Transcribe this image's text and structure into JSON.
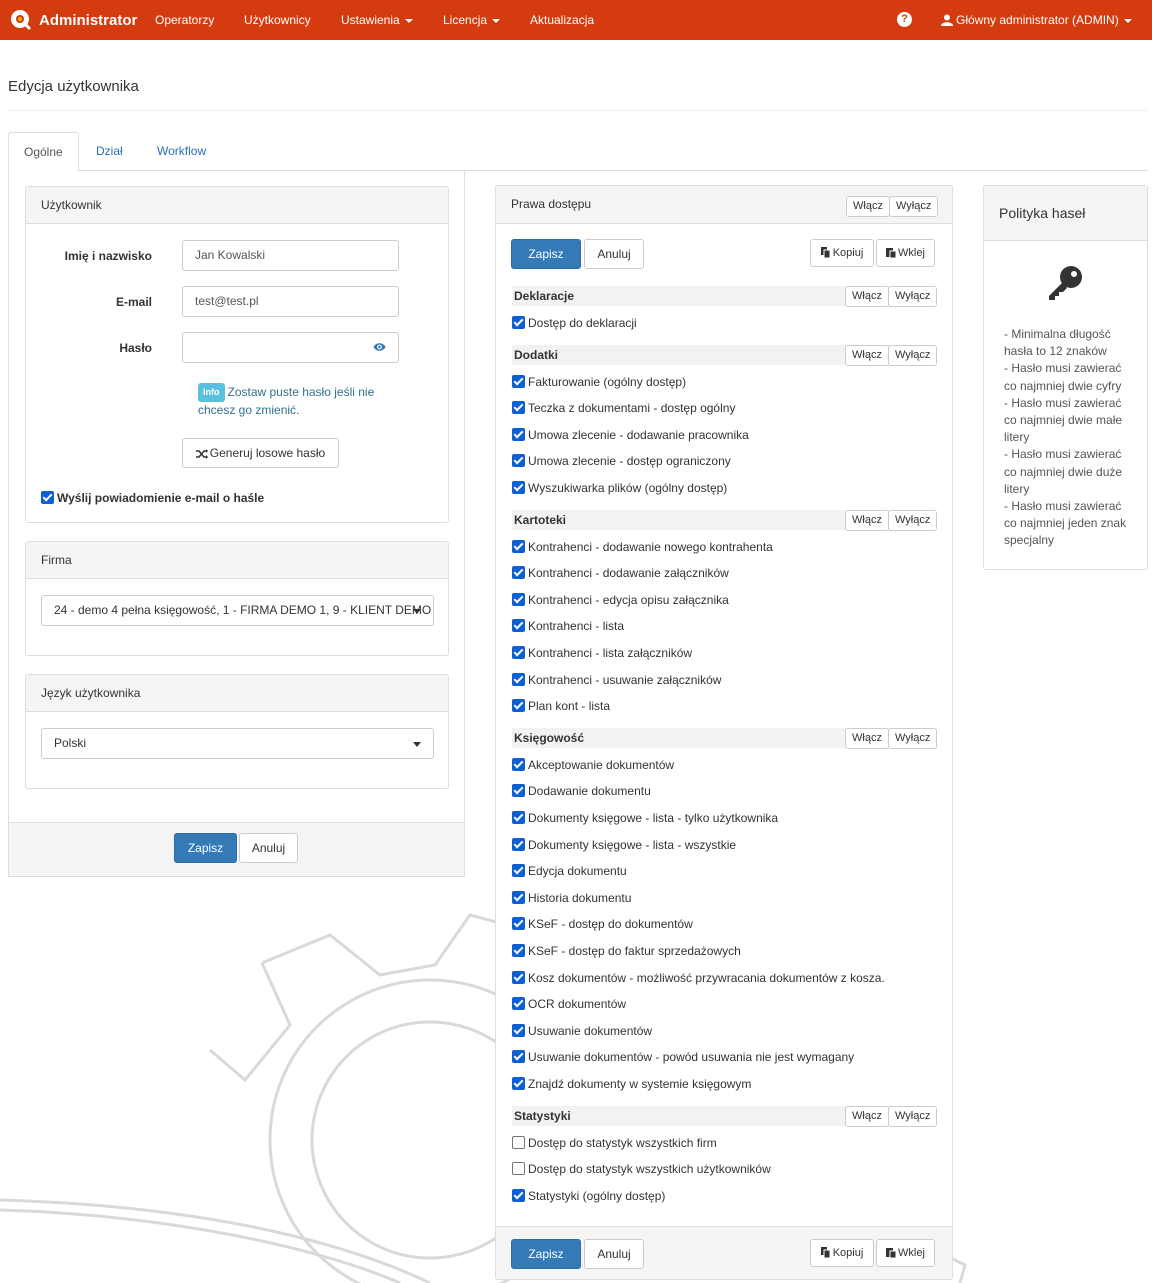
{
  "navbar": {
    "brand": "Administrator",
    "items": [
      "Operatorzy",
      "Użytkownicy",
      "Ustawienia",
      "Licencja",
      "Aktualizacja"
    ],
    "help": "?",
    "user": "Główny administrator (ADMIN)",
    "bg_color": "#d43b0f"
  },
  "page": {
    "title": "Edycja użytkownika"
  },
  "tabs": [
    "Ogólne",
    "Dział",
    "Workflow"
  ],
  "user_panel": {
    "heading": "Użytkownik",
    "name_label": "Imię i nazwisko",
    "name_value": "Jan Kowalski",
    "email_label": "E-mail",
    "email_value": "test@test.pl",
    "password_label": "Hasło",
    "password_value": "",
    "info_badge": "Info",
    "info_text": "Zostaw puste hasło jeśli nie chcesz go zmienić.",
    "generate_button": "Generuj losowe hasło",
    "notify_label": "Wyślij powiadomienie e-mail o haśle",
    "notify_checked": true
  },
  "company_panel": {
    "heading": "Firma",
    "selected": "24 - demo 4 pełna księgowość, 1 - FIRMA DEMO 1, 9 - KLIENT DEMO"
  },
  "language_panel": {
    "heading": "Język użytkownika",
    "selected": "Polski"
  },
  "left_footer": {
    "save": "Zapisz",
    "cancel": "Anuluj"
  },
  "rights": {
    "heading": "Prawa dostępu",
    "enable": "Włącz",
    "disable": "Wyłącz",
    "save": "Zapisz",
    "cancel": "Anuluj",
    "copy": "Kopiuj",
    "paste": "Wklej",
    "sections": [
      {
        "title": "Deklaracje",
        "items": [
          {
            "label": "Dostęp do deklaracji",
            "checked": true
          }
        ]
      },
      {
        "title": "Dodatki",
        "items": [
          {
            "label": "Fakturowanie (ogólny dostęp)",
            "checked": true
          },
          {
            "label": "Teczka z dokumentami - dostęp ogólny",
            "checked": true
          },
          {
            "label": "Umowa zlecenie - dodawanie pracownika",
            "checked": true
          },
          {
            "label": "Umowa zlecenie - dostęp ograniczony",
            "checked": true
          },
          {
            "label": "Wyszukiwarka plików (ogólny dostęp)",
            "checked": true
          }
        ]
      },
      {
        "title": "Kartoteki",
        "items": [
          {
            "label": "Kontrahenci - dodawanie nowego kontrahenta",
            "checked": true
          },
          {
            "label": "Kontrahenci - dodawanie załączników",
            "checked": true
          },
          {
            "label": "Kontrahenci - edycja opisu załącznika",
            "checked": true
          },
          {
            "label": "Kontrahenci - lista",
            "checked": true
          },
          {
            "label": "Kontrahenci - lista załączników",
            "checked": true
          },
          {
            "label": "Kontrahenci - usuwanie załączników",
            "checked": true
          },
          {
            "label": "Plan kont - lista",
            "checked": true
          }
        ]
      },
      {
        "title": "Księgowość",
        "items": [
          {
            "label": "Akceptowanie dokumentów",
            "checked": true
          },
          {
            "label": "Dodawanie dokumentu",
            "checked": true
          },
          {
            "label": "Dokumenty księgowe - lista - tylko użytkownika",
            "checked": true
          },
          {
            "label": "Dokumenty księgowe - lista - wszystkie",
            "checked": true
          },
          {
            "label": "Edycja dokumentu",
            "checked": true
          },
          {
            "label": "Historia dokumentu",
            "checked": true
          },
          {
            "label": "KSeF - dostęp do dokumentów",
            "checked": true
          },
          {
            "label": "KSeF - dostęp do faktur sprzedażowych",
            "checked": true
          },
          {
            "label": "Kosz dokumentów - możliwość przywracania dokumentów z kosza.",
            "checked": true
          },
          {
            "label": "OCR dokumentów",
            "checked": true
          },
          {
            "label": "Usuwanie dokumentów",
            "checked": true
          },
          {
            "label": "Usuwanie dokumentów - powód usuwania nie jest wymagany",
            "checked": true
          },
          {
            "label": "Znajdź dokumenty w systemie księgowym",
            "checked": true
          }
        ]
      },
      {
        "title": "Statystyki",
        "items": [
          {
            "label": "Dostęp do statystyk wszystkich firm",
            "checked": false
          },
          {
            "label": "Dostęp do statystyk wszystkich użytkowników",
            "checked": false
          },
          {
            "label": "Statystyki (ogólny dostęp)",
            "checked": true
          }
        ]
      }
    ]
  },
  "policy": {
    "heading": "Polityka haseł",
    "icon": "key-icon",
    "rules": [
      "- Minimalna długość hasła to 12 znaków",
      "- Hasło musi zawierać co najmniej dwie cyfry",
      "- Hasło musi zawierać co najmniej dwie małe litery",
      "- Hasło musi zawierać co najmniej dwie duże litery",
      "- Hasło musi zawierać co najmniej jeden znak specjalny"
    ]
  },
  "colors": {
    "primary": "#337ab7",
    "checkbox": "#0c5fd4",
    "link": "#2a6fb5"
  }
}
